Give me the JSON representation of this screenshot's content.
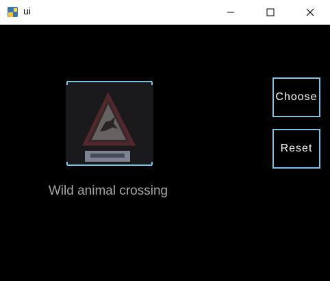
{
  "window": {
    "title": "ui",
    "controls": {
      "minimize_icon": "minimize-icon",
      "maximize_icon": "maximize-icon",
      "close_icon": "close-icon"
    }
  },
  "main": {
    "image": {
      "icon": "wild-animal-crossing-sign",
      "frame_color": "#7cc3e4"
    },
    "prediction_label": "Wild animal crossing",
    "buttons": {
      "choose_label": "Choose",
      "reset_label": "Reset"
    }
  },
  "colors": {
    "background": "#000000",
    "accent": "#7cc3e4",
    "label_text": "#a8a8a8",
    "button_text": "#ffffff"
  }
}
